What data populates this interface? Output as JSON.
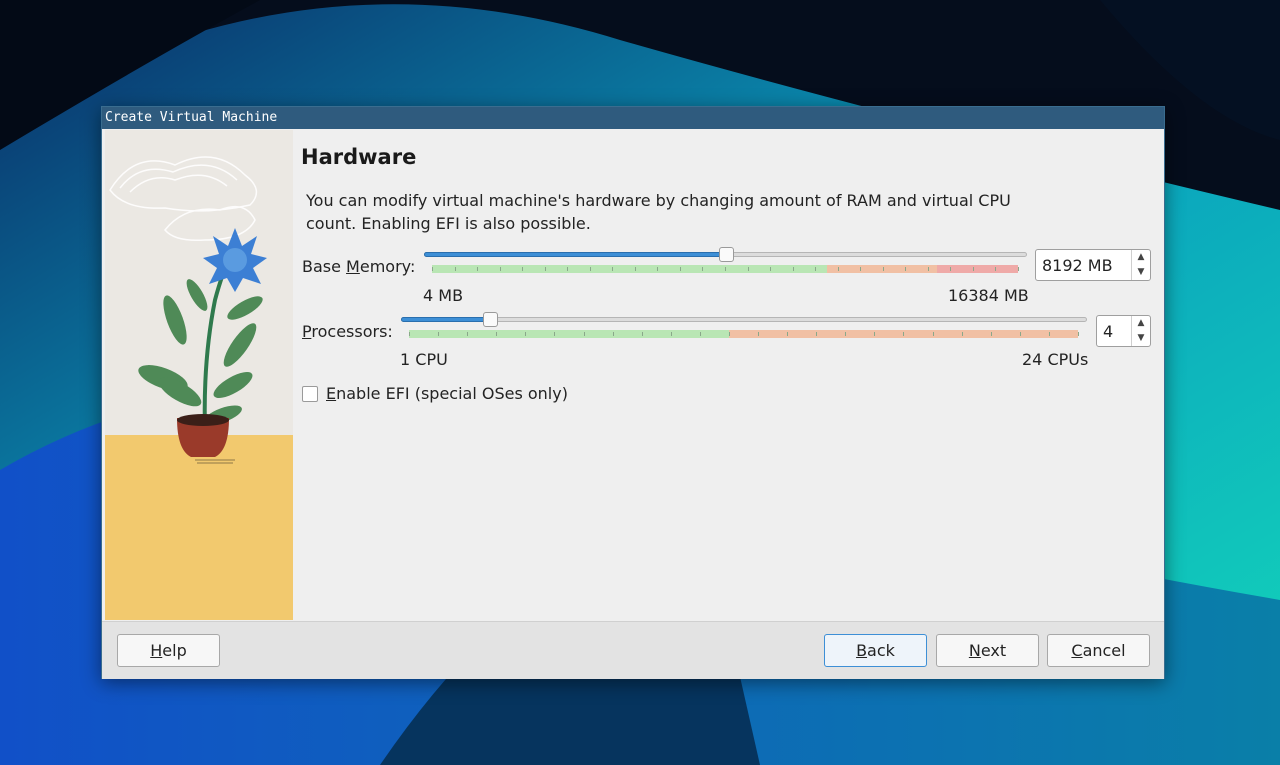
{
  "window": {
    "title": "Create Virtual Machine"
  },
  "page": {
    "heading": "Hardware",
    "description": "You can modify virtual machine's hardware by changing amount of RAM and virtual CPU count. Enabling EFI is also possible."
  },
  "memory": {
    "label_mnemonic": "M",
    "label_before": "Base ",
    "label_after": "emory:",
    "min_label": "4 MB",
    "max_label": "16384 MB",
    "value": "8192 MB",
    "fraction": 0.5
  },
  "processors": {
    "label_mnemonic": "P",
    "label_after": "rocessors:",
    "min_label": "1 CPU",
    "max_label": "24 CPUs",
    "value": "4",
    "fraction": 0.13
  },
  "efi": {
    "label_mnemonic": "E",
    "label_after": "nable EFI (special OSes only)",
    "checked": false
  },
  "buttons": {
    "help": {
      "mnemonic": "H",
      "rest": "elp"
    },
    "back": {
      "mnemonic": "B",
      "rest": "ack"
    },
    "next": {
      "mnemonic": "N",
      "rest": "ext"
    },
    "cancel": {
      "mnemonic": "C",
      "rest": "ancel"
    }
  },
  "icons": {
    "spin_up": "spin-up-icon",
    "spin_down": "spin-down-icon"
  },
  "colors": {
    "accent": "#3d8fd6",
    "titlebar": "#2f5b7e",
    "band_green": "#b9e6b4",
    "band_orange": "#f1c0a4",
    "band_red": "#efaaa8",
    "illustration_ground": "#f2c96e"
  }
}
